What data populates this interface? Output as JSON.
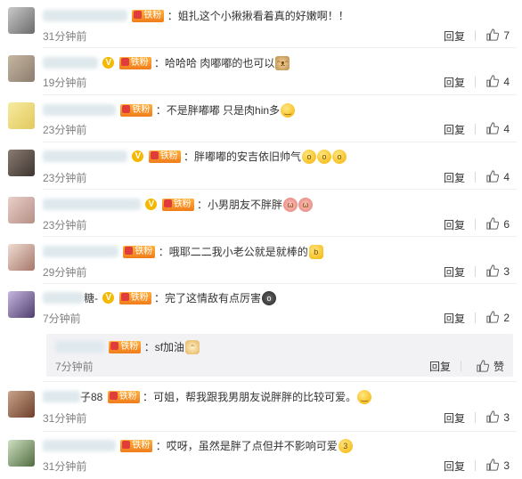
{
  "comments": [
    {
      "comment_text": "姐扎这个小揪揪看着真的好嫩啊！！",
      "time": "31分钟前",
      "reply_label": "回复",
      "likes": "7",
      "emoji": ""
    },
    {
      "comment_text": "哈哈哈 肉嘟嘟的也可以",
      "time": "19分钟前",
      "reply_label": "回复",
      "likes": "4",
      "emoji": "cat-emoji"
    },
    {
      "comment_text": "不是胖嘟嘟 只是肉hin多",
      "time": "23分钟前",
      "reply_label": "回复",
      "likes": "4",
      "emoji": "smile-emoji"
    },
    {
      "comment_text": "胖嘟嘟的安吉依旧帅气",
      "time": "23分钟前",
      "reply_label": "回复",
      "likes": "4",
      "emoji": "shocked-emoji"
    },
    {
      "comment_text": "小男朋友不胖胖",
      "time": "23分钟前",
      "reply_label": "回复",
      "likes": "6",
      "emoji": "pig-emoji"
    },
    {
      "comment_text": "哦耶二二我小老公就是就棒的",
      "time": "29分钟前",
      "reply_label": "回复",
      "likes": "3",
      "emoji": "thumbs-up-emoji"
    },
    {
      "name_suffix": "糖-",
      "comment_text": "完了这情敌有点厉害",
      "time": "7分钟前",
      "reply_label": "回复",
      "likes": "2",
      "emoji": "scared-emoji"
    },
    {
      "name_suffix": "子88",
      "comment_text": "可姐，帮我跟我男朋友说胖胖的比较可爱。",
      "time": "31分钟前",
      "reply_label": "回复",
      "likes": "3",
      "emoji": "smile-emoji"
    },
    {
      "comment_text": "哎呀，虽然是胖了点但并不影响可爱",
      "time": "31分钟前",
      "reply_label": "回复",
      "likes": "3",
      "emoji": "kiss-emoji"
    }
  ],
  "sub_reply": {
    "comment_text": "sf加油",
    "time": "7分钟前",
    "reply_label": "回复",
    "like_label": "赞",
    "emoji": "dog-emoji"
  },
  "badge_label": "铁粉",
  "colors": {
    "text": "#333333",
    "time": "#808080",
    "badge": "#f5a623",
    "subbox": "#f2f2f5"
  }
}
